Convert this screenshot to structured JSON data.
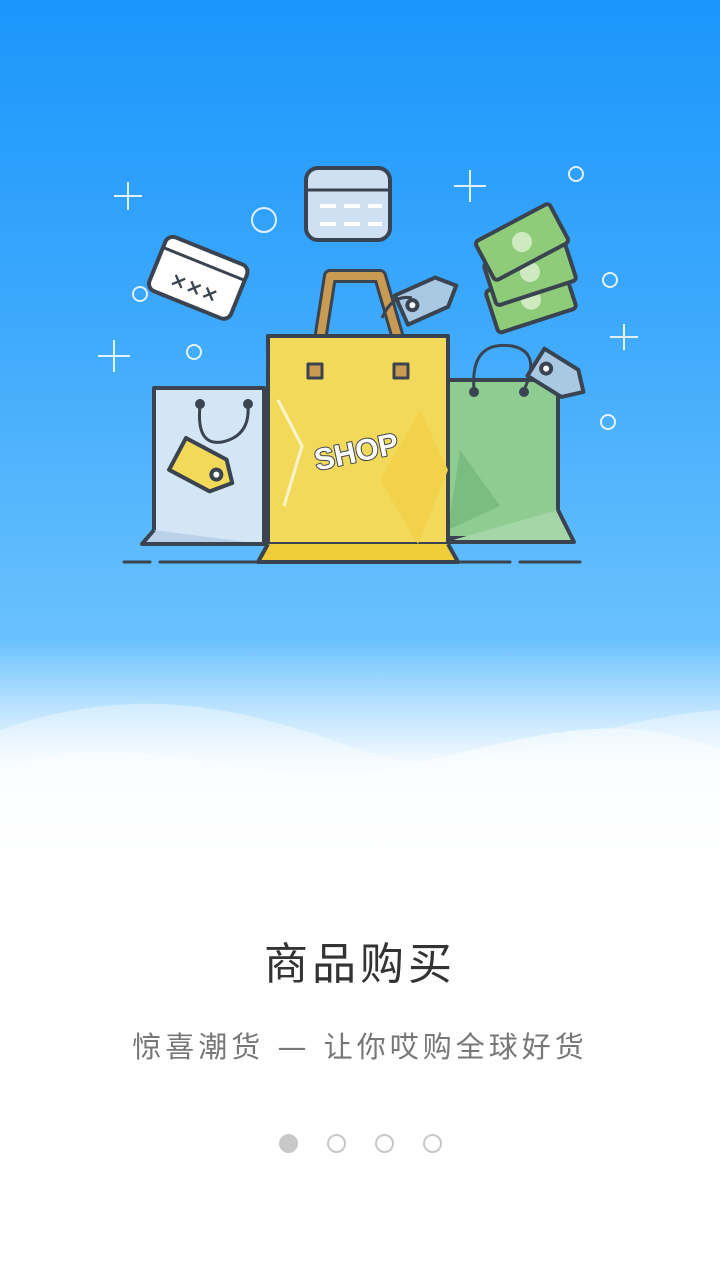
{
  "slide": {
    "illustration": {
      "name": "shopping-bags-illustration",
      "bag_label": "SHOP",
      "colors": {
        "sky_top": "#1a96fb",
        "sky_bottom": "#8ccffd",
        "yellow_bag": "#f3d95a",
        "green_bag": "#8fcc92",
        "blue_bag": "#d4e6f6",
        "outline": "#3a4450",
        "handle": "#c99a52",
        "money": "#8fcc7a",
        "tag_blue": "#a9c9e3"
      }
    },
    "title": "商品购买",
    "subtitle": "惊喜潮货 — 让你哎购全球好货"
  },
  "pager": {
    "total": 4,
    "active_index": 0,
    "dots": [
      {
        "name": "page-dot-1",
        "active": true
      },
      {
        "name": "page-dot-2",
        "active": false
      },
      {
        "name": "page-dot-3",
        "active": false
      },
      {
        "name": "page-dot-4",
        "active": false
      }
    ]
  }
}
